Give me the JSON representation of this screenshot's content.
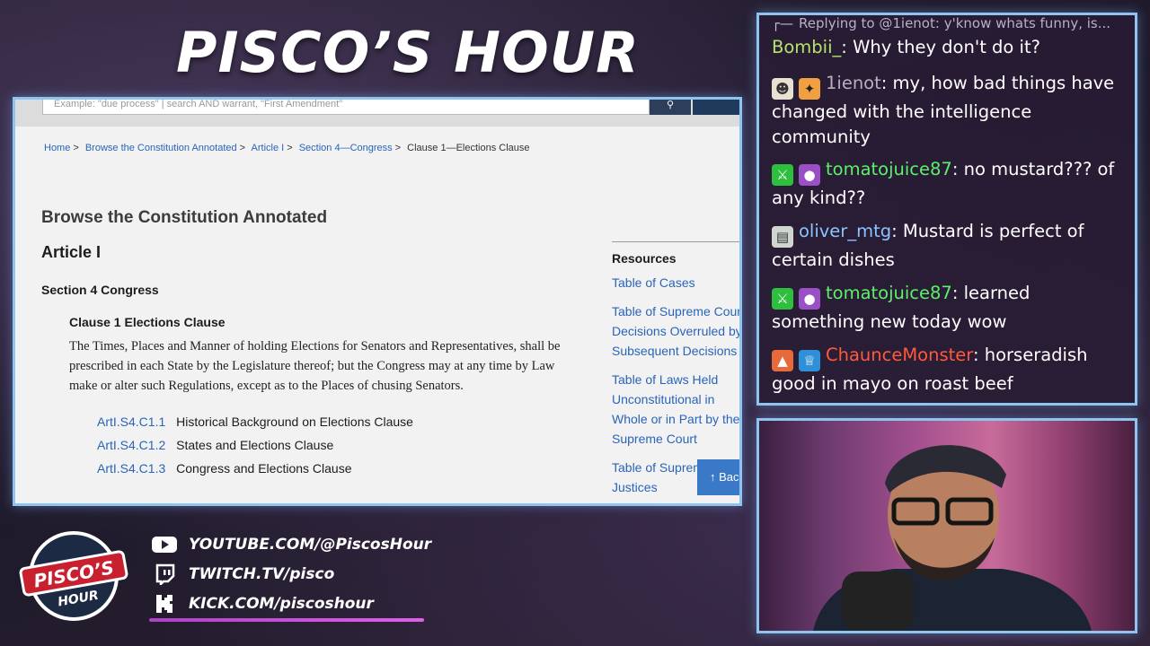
{
  "stream": {
    "title": "PISCO’S HOUR"
  },
  "browser": {
    "search_placeholder": "Example: \"due process\" | search AND warrant, \"First Amendment\"",
    "breadcrumb": [
      {
        "label": "Home"
      },
      {
        "label": "Browse the Constitution Annotated"
      },
      {
        "label": "Article I"
      },
      {
        "label": "Section 4—Congress"
      },
      {
        "label": "Clause 1—Elections Clause"
      }
    ],
    "page_heading": "Browse the Constitution Annotated",
    "article_heading": "Article I",
    "section_heading": "Section 4 Congress",
    "clause_heading": "Clause 1 Elections Clause",
    "clause_text": "The Times, Places and Manner of holding Elections for Senators and Representatives, shall be prescribed in each State by the Legislature thereof; but the Congress may at any time by Law make or alter such Regulations, except as to the Places of chusing Senators.",
    "sub_items": [
      {
        "code": "ArtI.S4.C1.1",
        "label": "Historical Background on Elections Clause"
      },
      {
        "code": "ArtI.S4.C1.2",
        "label": "States and Elections Clause"
      },
      {
        "code": "ArtI.S4.C1.3",
        "label": "Congress and Elections Clause"
      }
    ],
    "resources": {
      "title": "Resources",
      "links": [
        "Table of Cases",
        "Table of Supreme Court Decisions Overruled by Subsequent Decisions",
        "Table of Laws Held Unconstitutional in Whole or in Part by the Supreme Court",
        "Table of Supreme Court Justices"
      ]
    },
    "back_button": "Back"
  },
  "chat": {
    "reply": {
      "text": "Replying to @1ienot: y'know whats funny, is..."
    },
    "messages": [
      {
        "user": "Bombii_",
        "user_color": "#b6e36b",
        "text": "Why they don't do it?"
      },
      {
        "user": "1ienot",
        "user_color": "#b8b0bf",
        "text": "my, how bad things have changed with the intelligence community"
      },
      {
        "user": "tomatojuice87",
        "user_color": "#5cf06a",
        "text": "no mustard??? of any kind??"
      },
      {
        "user": "oliver_mtg",
        "user_color": "#8cc4ff",
        "text": "Mustard is perfect of certain dishes"
      },
      {
        "user": "tomatojuice87",
        "user_color": "#5cf06a",
        "text": "learned something new today wow"
      },
      {
        "user": "ChaunceMonster",
        "user_color": "#ff5a3c",
        "text": "horseradish good in mayo on roast beef"
      }
    ]
  },
  "socials": [
    {
      "icon": "youtube-icon",
      "label": "YOUTUBE.COM/@PiscosHour"
    },
    {
      "icon": "twitch-icon",
      "label": "TWITCH.TV/pisco"
    },
    {
      "icon": "kick-icon",
      "label": "KICK.COM/piscoshour"
    }
  ],
  "logo": {
    "line1": "PISCO’S",
    "line2": "HOUR"
  }
}
